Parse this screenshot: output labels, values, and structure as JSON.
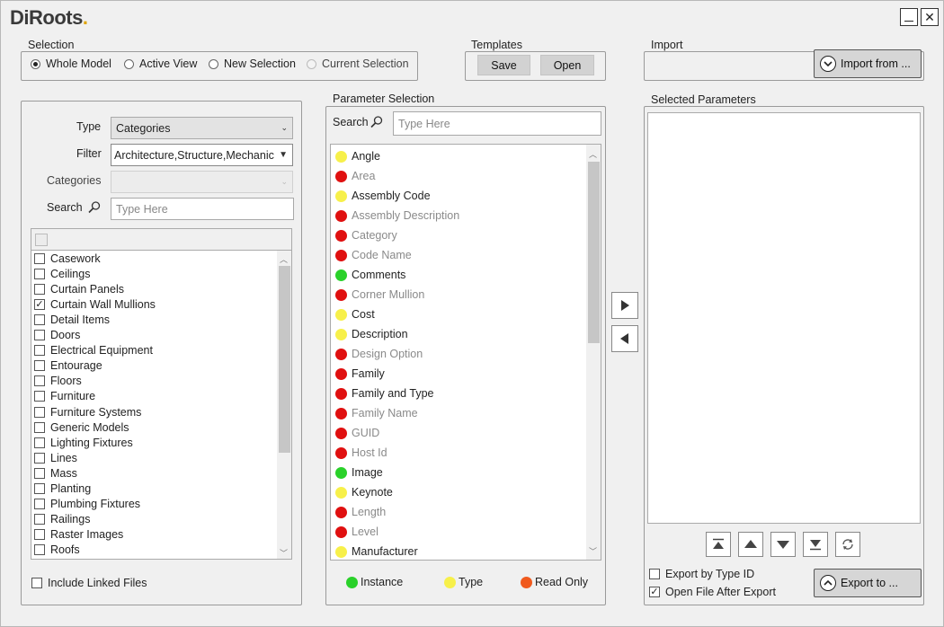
{
  "app": {
    "logo_text": "DiRoots",
    "minimize_label": "_",
    "close_label": "✕"
  },
  "selection": {
    "title": "Selection",
    "options": [
      {
        "label": "Whole Model",
        "selected": true,
        "enabled": true
      },
      {
        "label": "Active View",
        "selected": false,
        "enabled": true
      },
      {
        "label": "New Selection",
        "selected": false,
        "enabled": true
      },
      {
        "label": "Current Selection",
        "selected": false,
        "enabled": false
      }
    ]
  },
  "templates": {
    "title": "Templates",
    "save_label": "Save",
    "open_label": "Open"
  },
  "import": {
    "title": "Import",
    "button_label": "Import from ..."
  },
  "left": {
    "type_label": "Type",
    "type_value": "Categories",
    "filter_label": "Filter",
    "filter_value": "Architecture,Structure,Mechanic",
    "categories_label": "Categories",
    "categories_value": "",
    "search_label": "Search",
    "search_placeholder": "Type Here",
    "items": [
      {
        "label": "Casework",
        "checked": false
      },
      {
        "label": "Ceilings",
        "checked": false
      },
      {
        "label": "Curtain Panels",
        "checked": false
      },
      {
        "label": "Curtain Wall Mullions",
        "checked": true
      },
      {
        "label": "Detail Items",
        "checked": false
      },
      {
        "label": "Doors",
        "checked": false
      },
      {
        "label": "Electrical Equipment",
        "checked": false
      },
      {
        "label": "Entourage",
        "checked": false
      },
      {
        "label": "Floors",
        "checked": false
      },
      {
        "label": "Furniture",
        "checked": false
      },
      {
        "label": "Furniture Systems",
        "checked": false
      },
      {
        "label": "Generic Models",
        "checked": false
      },
      {
        "label": "Lighting Fixtures",
        "checked": false
      },
      {
        "label": "Lines",
        "checked": false
      },
      {
        "label": "Mass",
        "checked": false
      },
      {
        "label": "Planting",
        "checked": false
      },
      {
        "label": "Plumbing Fixtures",
        "checked": false
      },
      {
        "label": "Railings",
        "checked": false
      },
      {
        "label": "Raster Images",
        "checked": false
      },
      {
        "label": "Roofs",
        "checked": false
      }
    ],
    "include_linked_label": "Include Linked Files"
  },
  "parameters": {
    "title": "Parameter Selection",
    "search_label": "Search",
    "search_placeholder": "Type Here",
    "items": [
      {
        "label": "Angle",
        "kind": "yellow",
        "readonly": false
      },
      {
        "label": "Area",
        "kind": "red",
        "readonly": true
      },
      {
        "label": "Assembly Code",
        "kind": "yellow",
        "readonly": false
      },
      {
        "label": "Assembly Description",
        "kind": "red",
        "readonly": true
      },
      {
        "label": "Category",
        "kind": "red",
        "readonly": true
      },
      {
        "label": "Code Name",
        "kind": "red",
        "readonly": true
      },
      {
        "label": "Comments",
        "kind": "green",
        "readonly": false
      },
      {
        "label": "Corner Mullion",
        "kind": "red",
        "readonly": true
      },
      {
        "label": "Cost",
        "kind": "yellow",
        "readonly": false
      },
      {
        "label": "Description",
        "kind": "yellow",
        "readonly": false
      },
      {
        "label": "Design Option",
        "kind": "red",
        "readonly": true
      },
      {
        "label": "Family",
        "kind": "red",
        "readonly": false
      },
      {
        "label": "Family and Type",
        "kind": "red",
        "readonly": false
      },
      {
        "label": "Family Name",
        "kind": "red",
        "readonly": true
      },
      {
        "label": "GUID",
        "kind": "red",
        "readonly": true
      },
      {
        "label": "Host Id",
        "kind": "red",
        "readonly": true
      },
      {
        "label": "Image",
        "kind": "green",
        "readonly": false
      },
      {
        "label": "Keynote",
        "kind": "yellow",
        "readonly": false
      },
      {
        "label": "Length",
        "kind": "red",
        "readonly": true
      },
      {
        "label": "Level",
        "kind": "red",
        "readonly": true
      },
      {
        "label": "Manufacturer",
        "kind": "yellow",
        "readonly": false
      }
    ],
    "legend": [
      {
        "label": "Instance",
        "color": "#2ad12a"
      },
      {
        "label": "Type",
        "color": "#f7f04a"
      },
      {
        "label": "Read Only",
        "color": "#f05a1e"
      }
    ]
  },
  "selected": {
    "title": "Selected Parameters",
    "export_by_type_label": "Export by Type ID",
    "export_by_type_checked": false,
    "open_after_label": "Open File After Export",
    "open_after_checked": true,
    "export_button_label": "Export to ..."
  }
}
